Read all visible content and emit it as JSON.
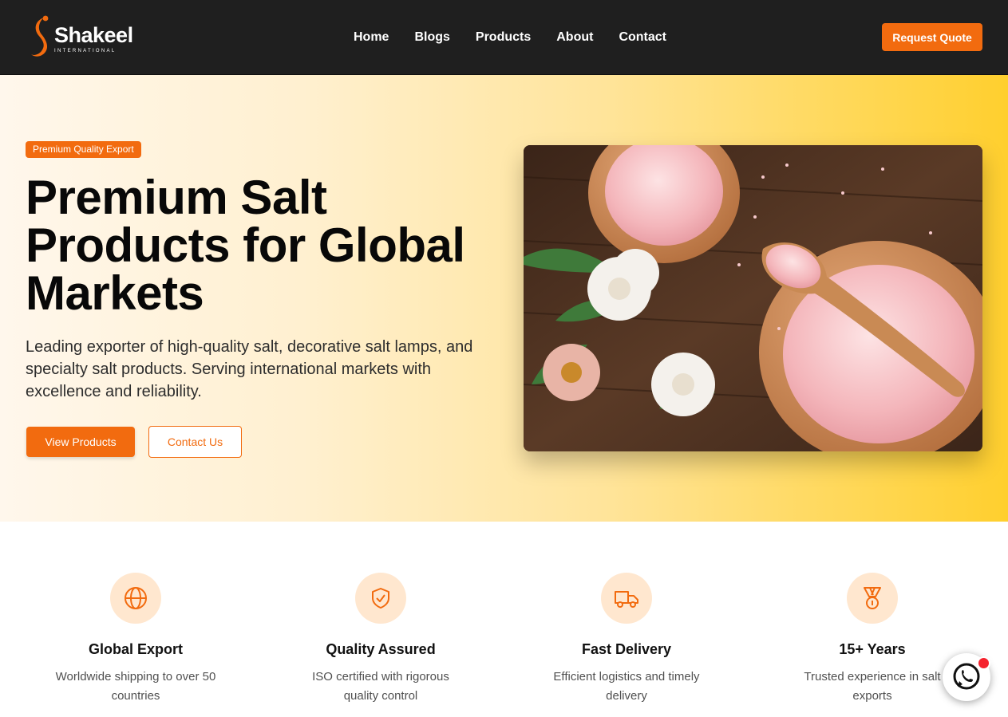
{
  "brand": {
    "name": "Shakeel",
    "tagline": "INTERNATIONAL",
    "accent_color": "#f26b0f"
  },
  "nav": {
    "items": [
      {
        "label": "Home"
      },
      {
        "label": "Blogs"
      },
      {
        "label": "Products"
      },
      {
        "label": "About"
      },
      {
        "label": "Contact"
      }
    ],
    "cta_label": "Request Quote"
  },
  "hero": {
    "badge": "Premium Quality Export",
    "title_lines": [
      "Premium Salt",
      "Products for Global",
      "Markets"
    ],
    "description": "Leading exporter of high-quality salt, decorative salt lamps, and specialty salt products. Serving international markets with excellence and reliability.",
    "primary_button": "View Products",
    "secondary_button": "Contact Us",
    "image": "pink-salt-bowls-wooden-spoon-flowers"
  },
  "features": [
    {
      "icon": "globe-icon",
      "title": "Global Export",
      "description": "Worldwide shipping to over 50 countries"
    },
    {
      "icon": "shield-check-icon",
      "title": "Quality Assured",
      "description": "ISO certified with rigorous quality control"
    },
    {
      "icon": "truck-icon",
      "title": "Fast Delivery",
      "description": "Efficient logistics and timely delivery"
    },
    {
      "icon": "medal-icon",
      "title": "15+ Years",
      "description": "Trusted experience in salt exports"
    }
  ],
  "chat": {
    "icon": "whatsapp-icon",
    "notification_color": "#f5222d"
  }
}
